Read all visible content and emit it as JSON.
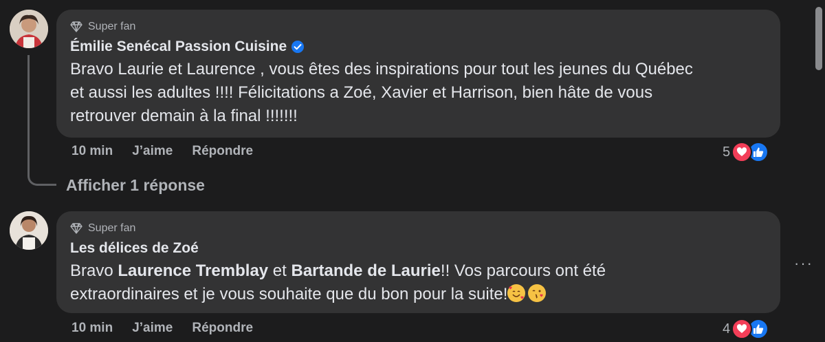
{
  "comments": [
    {
      "badge": "Super fan",
      "author": "Émilie Senécal Passion Cuisine",
      "verified": true,
      "text_line1": "Bravo Laurie et Laurence , vous êtes des inspirations pour tout les jeunes du Québec",
      "text_line2": "et aussi les adultes !!!! Félicitations a Zoé, Xavier et Harrison, bien hâte de vous",
      "text_line3": "retrouver demain à la final !!!!!!!",
      "time": "10 min",
      "like_label": "J’aime",
      "reply_label": "Répondre",
      "reaction_count": "5"
    },
    {
      "badge": "Super fan",
      "author": "Les délices de Zoé",
      "verified": false,
      "text_prefix": "Bravo ",
      "mention1": "Laurence Tremblay",
      "text_mid": " et ",
      "mention2": "Bartande de Laurie",
      "text_line1_end": "!! Vos parcours ont été",
      "text_line2": "extraordinaires et je vous souhaite que du bon pour la suite!",
      "time": "10 min",
      "like_label": "J’aime",
      "reply_label": "Répondre",
      "reaction_count": "4"
    }
  ],
  "view_replies": "Afficher 1 réponse",
  "more_options": "···",
  "colors": {
    "background": "#1c1c1d",
    "bubble": "#333334",
    "verified": "#1877f2",
    "love": "#f33e58",
    "like": "#1877f2"
  }
}
